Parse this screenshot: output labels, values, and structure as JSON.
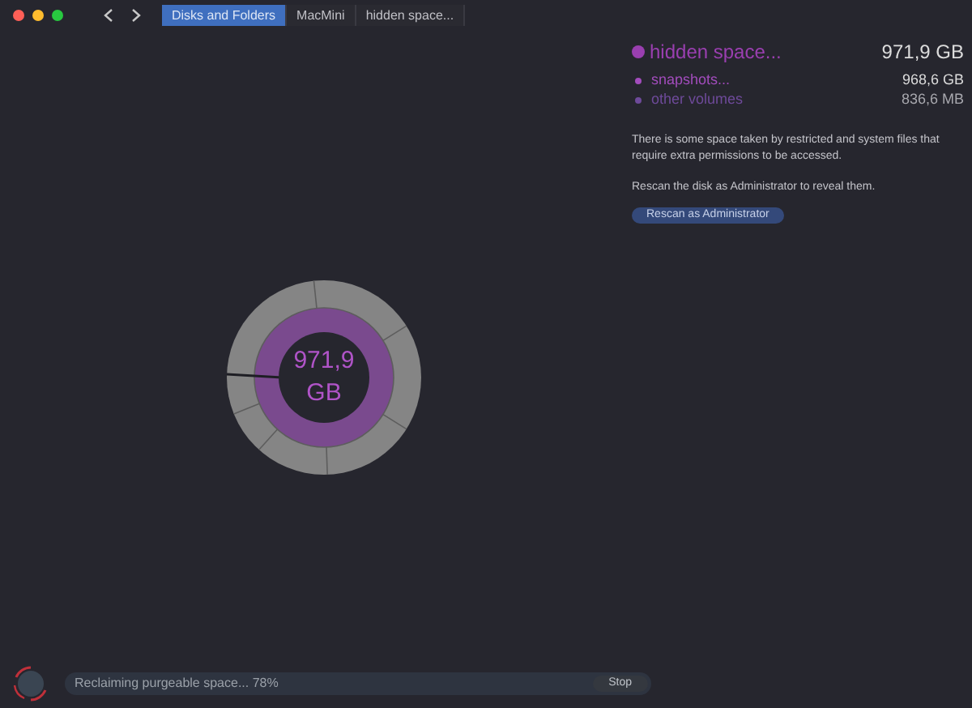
{
  "breadcrumbs": [
    {
      "label": "Disks and Folders",
      "selected": true
    },
    {
      "label": "MacMini",
      "selected": false
    },
    {
      "label": "hidden space...",
      "selected": false
    }
  ],
  "chart": {
    "center_value": "971,9",
    "center_unit": "GB"
  },
  "legend": [
    {
      "kind": "primary",
      "label": "hidden space...",
      "value": "971,9 GB",
      "color": "#9a3fb0"
    },
    {
      "kind": "secondary",
      "label": "snapshots...",
      "value": "968,6 GB",
      "color": "#a24cbc"
    },
    {
      "kind": "secondary",
      "label": "other volumes",
      "value": "836,6 MB",
      "color": "#6e4a9a"
    }
  ],
  "info": [
    "There is some space taken by restricted and system files that require extra permissions to be accessed.",
    "Rescan the disk as Administrator to reveal them."
  ],
  "rescan_button": "Rescan as Administrator",
  "status": {
    "text": "Reclaiming purgeable space... 78%",
    "stop_button": "Stop"
  }
}
